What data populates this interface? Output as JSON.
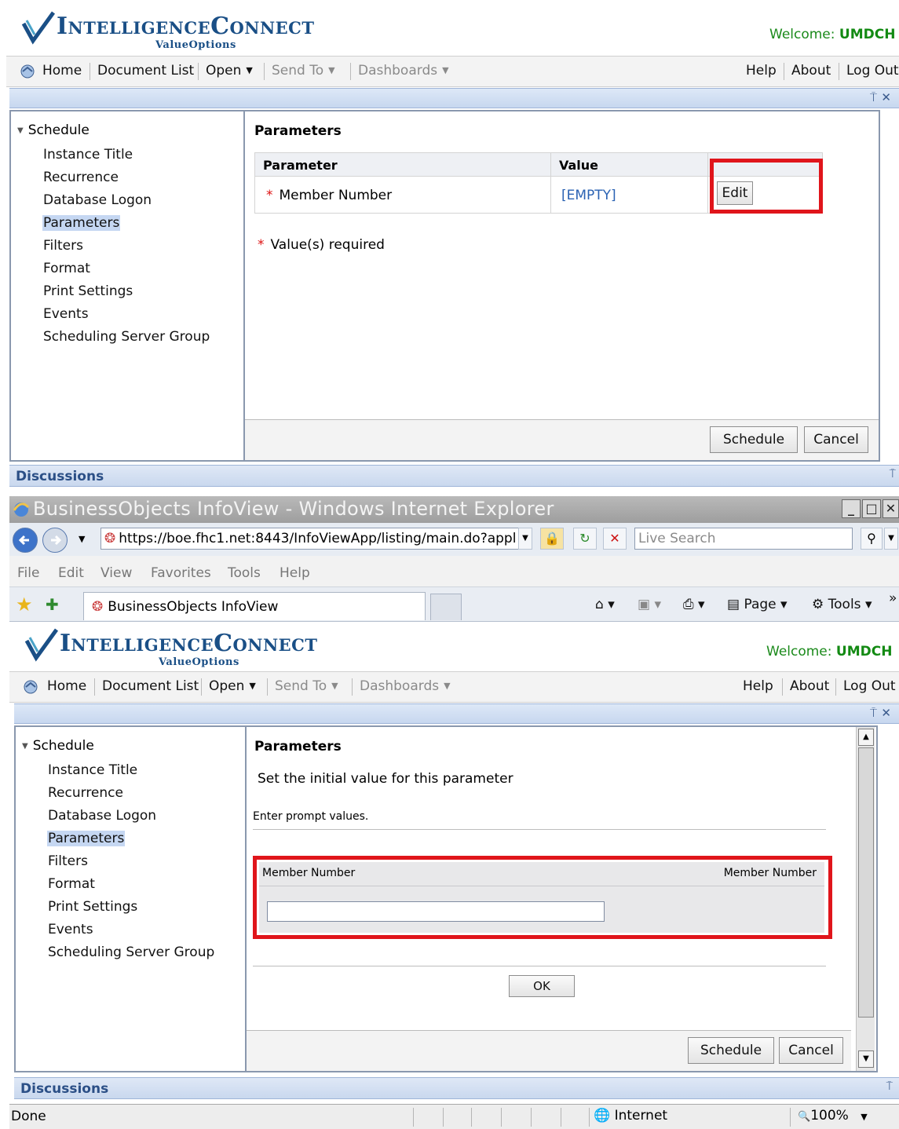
{
  "app": {
    "logo_title": "IntelligenceConnect",
    "logo_subtitle": "ValueOptions",
    "welcome_prefix": "Welcome:",
    "welcome_user": "UMDCH"
  },
  "menu": {
    "home": "Home",
    "document_list": "Document List",
    "open": "Open",
    "send_to": "Send To",
    "dashboards": "Dashboards",
    "help": "Help",
    "about": "About",
    "logout": "Log Out"
  },
  "nav": {
    "section": "Schedule",
    "items": [
      "Instance Title",
      "Recurrence",
      "Database Logon",
      "Parameters",
      "Filters",
      "Format",
      "Print Settings",
      "Events",
      "Scheduling Server Group"
    ],
    "selected": "Parameters"
  },
  "panel1": {
    "heading": "Parameters",
    "col_parameter": "Parameter",
    "col_value": "Value",
    "row_required_mark": "*",
    "row_parameter": "Member Number",
    "row_value": "[EMPTY]",
    "edit_button": "Edit",
    "required_note_mark": "*",
    "required_note": "Value(s) required",
    "schedule_button": "Schedule",
    "cancel_button": "Cancel"
  },
  "discussions": "Discussions",
  "ie": {
    "window_title": "BusinessObjects InfoView - Windows Internet Explorer",
    "url": "https://boe.fhc1.net:8443/InfoViewApp/listing/main.do?appl",
    "search_placeholder": "Live Search",
    "menu": [
      "File",
      "Edit",
      "View",
      "Favorites",
      "Tools",
      "Help"
    ],
    "tab_title": "BusinessObjects InfoView",
    "cmd_page": "Page",
    "cmd_tools": "Tools",
    "status_done": "Done",
    "status_zone": "Internet",
    "status_zoom": "100%"
  },
  "panel2": {
    "heading": "Parameters",
    "subtitle": "Set the initial value for this parameter",
    "prompt_instruction": "Enter prompt values.",
    "prompt_label_left": "Member Number",
    "prompt_label_right": "Member Number",
    "input_value": "",
    "ok_button": "OK",
    "schedule_button": "Schedule",
    "cancel_button": "Cancel"
  },
  "colors": {
    "highlight_box": "#e0151b",
    "brand_blue": "#1a4f86",
    "welcome_green": "#1b8a1b",
    "selected_nav": "#c5d7f2"
  },
  "icons": [
    "check-logo-icon",
    "home-icon",
    "back-icon",
    "forward-icon",
    "lock-icon",
    "refresh-icon",
    "stop-icon",
    "search-icon",
    "favorites-star-icon",
    "add-favorites-icon",
    "home-page-icon",
    "feeds-icon",
    "print-icon",
    "page-icon",
    "tools-gear-icon",
    "globe-icon",
    "zoom-icon"
  ]
}
